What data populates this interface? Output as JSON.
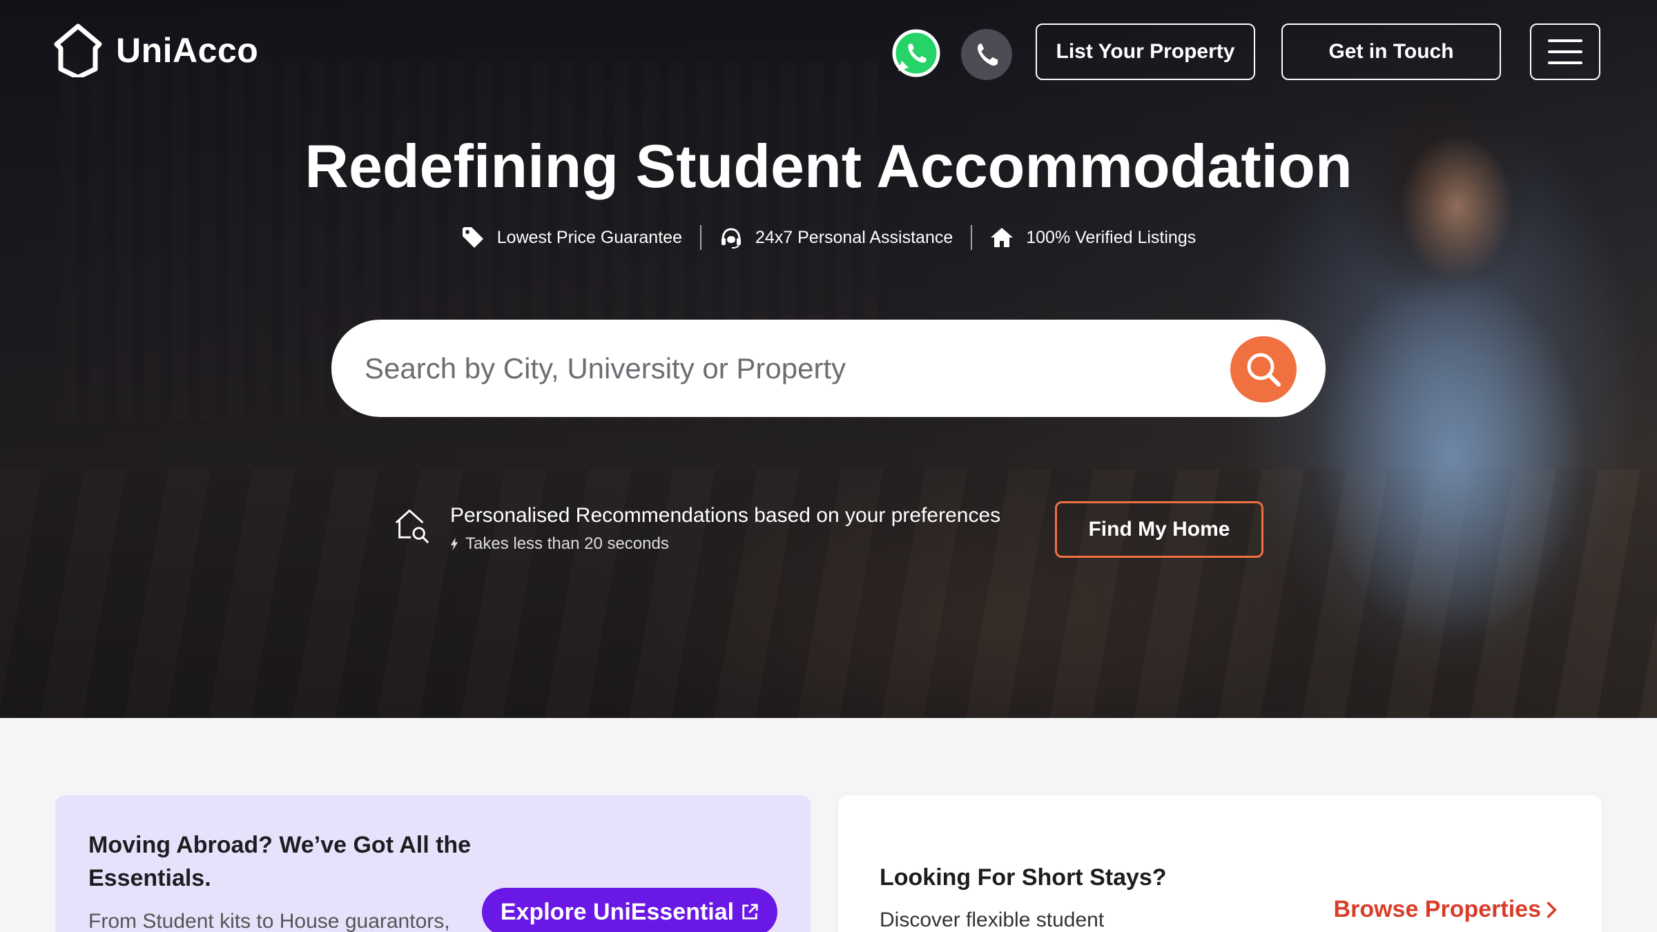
{
  "header": {
    "brand": "UniAcco",
    "list_property": "List Your Property",
    "get_in_touch": "Get in Touch"
  },
  "hero": {
    "title": "Redefining Student Accommodation",
    "features": [
      {
        "label": "Lowest Price Guarantee",
        "icon": "price-tag-icon"
      },
      {
        "label": "24x7 Personal Assistance",
        "icon": "headset-icon"
      },
      {
        "label": "100% Verified Listings",
        "icon": "home-icon"
      }
    ],
    "search": {
      "placeholder": "Search by City, University or Property"
    },
    "recommendation": {
      "title": "Personalised Recommendations based on your preferences",
      "subtitle": "Takes less than 20 seconds",
      "cta": "Find My Home"
    }
  },
  "cards": {
    "essentials": {
      "title": "Moving Abroad? We’ve Got All the Essentials.",
      "description": "From Student kits to House guarantors,",
      "cta": "Explore UniEssential"
    },
    "short_stays": {
      "title": "Looking For Short Stays?",
      "description": "Discover flexible student",
      "cta": "Browse Properties"
    }
  },
  "colors": {
    "accent_orange": "#f0703f",
    "purple": "#6a18e6",
    "browse_red": "#d93d2a",
    "whatsapp_green": "#25d366"
  }
}
